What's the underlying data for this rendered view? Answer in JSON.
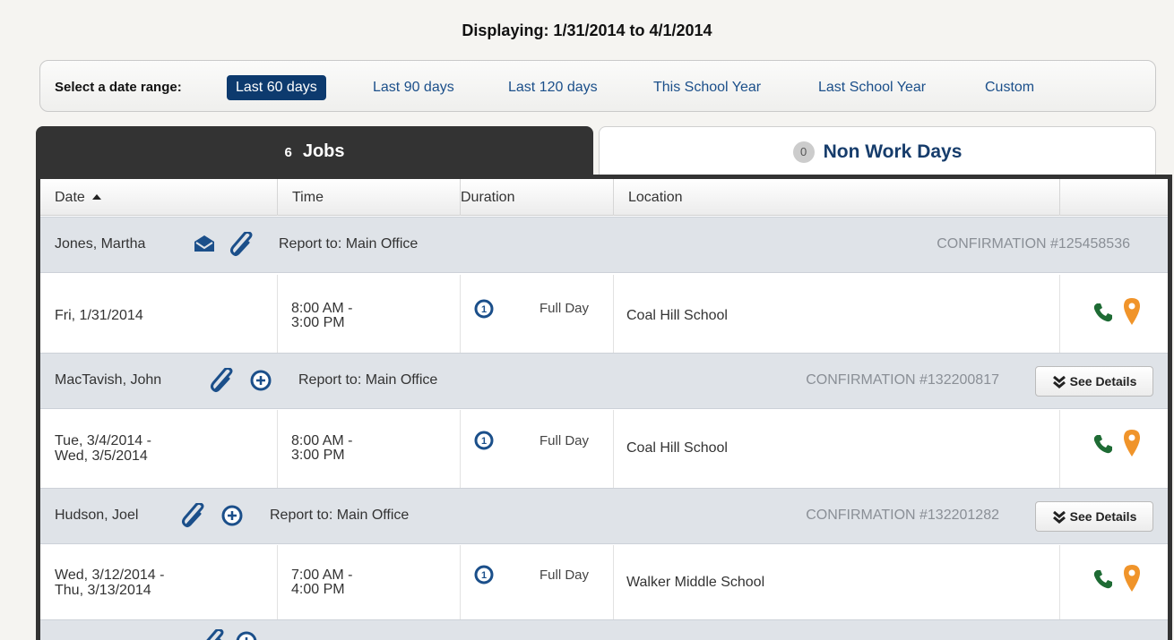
{
  "displaying": "Displaying: 1/31/2014  to  4/1/2014",
  "date_range": {
    "label": "Select a date range:",
    "options": [
      "Last 60 days",
      "Last 90 days",
      "Last 120 days",
      "This School Year",
      "Last School Year",
      "Custom"
    ],
    "selected": "Last 60 days"
  },
  "tabs": {
    "jobs": {
      "count": "6",
      "label": "Jobs"
    },
    "non_work_days": {
      "count": "0",
      "label": "Non Work Days"
    }
  },
  "columns": [
    "Date",
    "Time",
    "Duration",
    "Location"
  ],
  "see_details_label": "See Details",
  "jobs": [
    {
      "name": "Jones, Martha",
      "report": "Report to: Main Office",
      "confirmation": "CONFIRMATION #125458536",
      "date_line1": "Fri, 1/31/2014",
      "date_line2": "",
      "time_line1": "8:00 AM -",
      "time_line2": "3:00 PM",
      "duration": "Full Day",
      "location": "Coal Hill School"
    },
    {
      "name": "MacTavish, John",
      "report": "Report to: Main Office",
      "confirmation": "CONFIRMATION #132200817",
      "date_line1": "Tue, 3/4/2014 -",
      "date_line2": "Wed, 3/5/2014",
      "time_line1": "8:00 AM -",
      "time_line2": "3:00 PM",
      "duration": "Full Day",
      "location": "Coal Hill School"
    },
    {
      "name": "Hudson, Joel",
      "report": "Report to: Main Office",
      "confirmation": "CONFIRMATION #132201282",
      "date_line1": "Wed, 3/12/2014 -",
      "date_line2": "Thu, 3/13/2014",
      "time_line1": "7:00 AM -",
      "time_line2": "4:00 PM",
      "duration": "Full Day",
      "location": "Walker Middle School"
    }
  ],
  "colors": {
    "accent": "#0d3a6e",
    "tab_dark": "#333333",
    "phone": "#1e6b34",
    "pin": "#f0942a",
    "duration_icon": "#1b4f8a"
  }
}
